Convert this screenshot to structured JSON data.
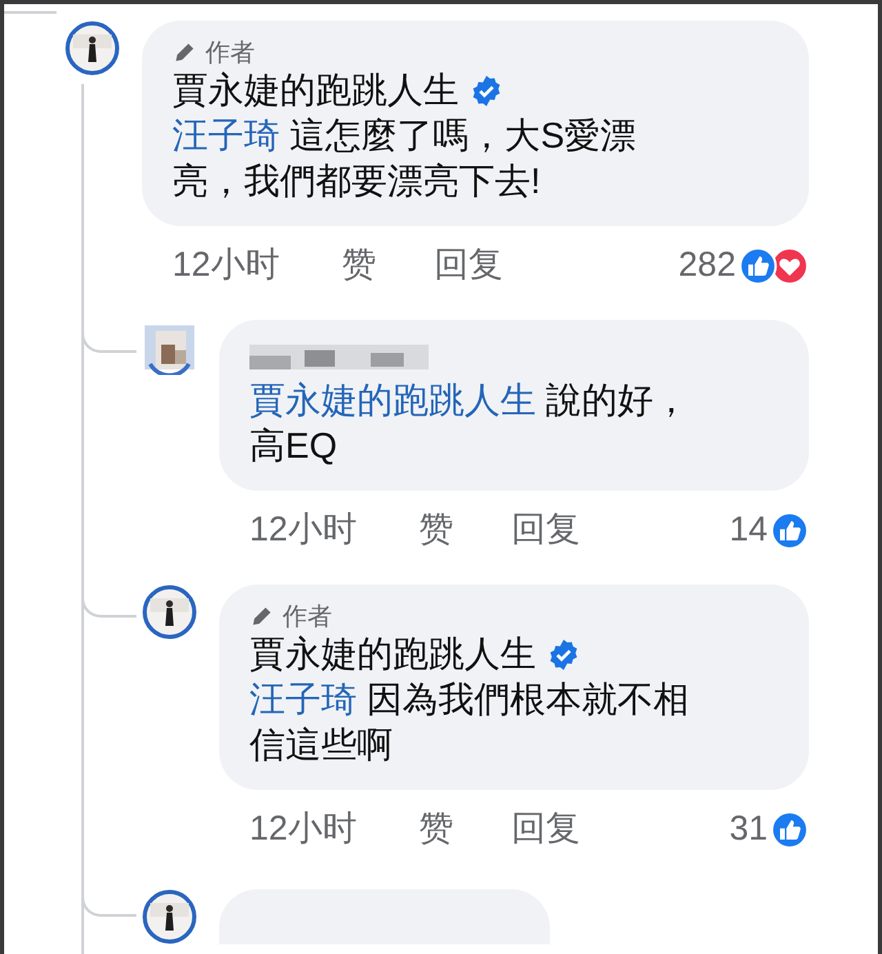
{
  "comments": [
    {
      "kind": "author",
      "badge": "作者",
      "author": "賈永婕的跑跳人生",
      "verified": true,
      "mention": "汪子琦",
      "text": "這怎麼了嗎，大S愛漂亮，我們都要漂亮下去!",
      "time": "12小时",
      "like": "赞",
      "reply": "回复",
      "count": "282",
      "like_reaction": true,
      "love_reaction": true
    },
    {
      "kind": "hidden",
      "mention": "賈永婕的跑跳人生",
      "text": "說的好，高EQ",
      "time": "12小时",
      "like": "赞",
      "reply": "回复",
      "count": "14",
      "like_reaction": true,
      "love_reaction": false
    },
    {
      "kind": "author",
      "badge": "作者",
      "author": "賈永婕的跑跳人生",
      "verified": true,
      "mention": "汪子琦",
      "text": "因為我們根本就不相信這些啊",
      "time": "12小时",
      "like": "赞",
      "reply": "回复",
      "count": "31",
      "like_reaction": true,
      "love_reaction": false
    },
    {
      "kind": "cut"
    }
  ]
}
